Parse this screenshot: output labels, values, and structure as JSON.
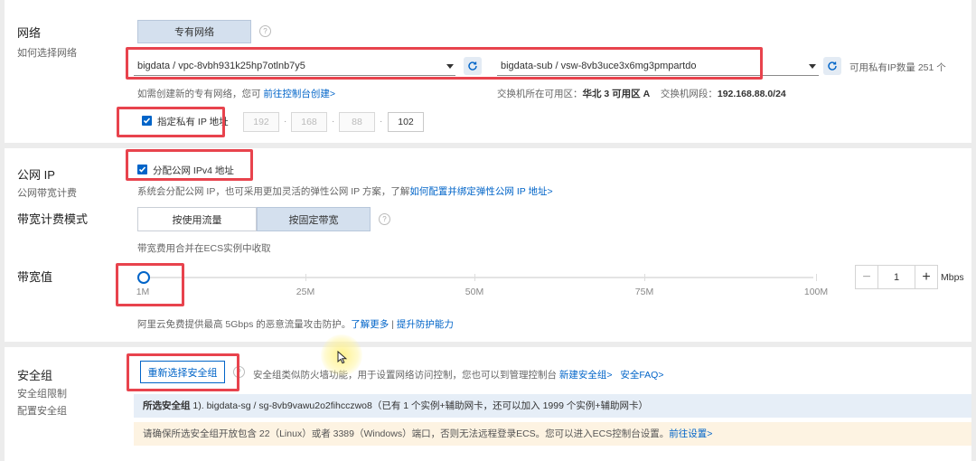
{
  "network": {
    "title": "网络",
    "subtitle": "如何选择网络",
    "vpc_button": "专有网络",
    "vpc_select": "bigdata / vpc-8vbh931k25hp7otlnb7y5",
    "vswitch_select": "bigdata-sub / vsw-8vb3uce3x6mg3pmpartdo",
    "available_ip": "可用私有IP数量 251 个",
    "create_hint": "如需创建新的专有网络，您可",
    "create_link": "前往控制台创建>",
    "zone_label": "交换机所在可用区：",
    "zone_value": "华北 3 可用区 A",
    "cidr_label": "交换机网段：",
    "cidr_value": "192.168.88.0/24",
    "private_ip_checkbox": "指定私有 IP 地址",
    "ip_octets": [
      "192",
      "168",
      "88",
      "102"
    ]
  },
  "public_ip": {
    "title": "公网 IP",
    "subtitle": "公网带宽计费",
    "checkbox": "分配公网 IPv4 地址",
    "hint": "系统会分配公网 IP，也可采用更加灵活的弹性公网 IP 方案，了解",
    "hint_link": "如何配置并绑定弹性公网 IP 地址>",
    "billing_title": "带宽计费模式",
    "billing_options": [
      "按使用流量",
      "按固定带宽"
    ],
    "billing_hint": "带宽费用合并在ECS实例中收取",
    "bandwidth_title": "带宽值",
    "slider_ticks": [
      "1M",
      "25M",
      "50M",
      "75M",
      "100M"
    ],
    "bandwidth_value": "1",
    "bandwidth_unit": "Mbps",
    "bandwidth_level": 1,
    "ddos_hint": "阿里云免费提供最高 5Gbps 的恶意流量攻击防护。",
    "ddos_link1": "了解更多",
    "ddos_sep": "|",
    "ddos_link2": "提升防护能力"
  },
  "security": {
    "title": "安全组",
    "subtitle1": "安全组限制",
    "subtitle2": "配置安全组",
    "reselect_button": "重新选择安全组",
    "desc": "安全组类似防火墙功能，用于设置网络访问控制，您也可以到管理控制台",
    "new_link": "新建安全组>",
    "faq_link": "安全FAQ>",
    "selected_label": "所选安全组",
    "selected_value": "1). bigdata-sg / sg-8vb9vawu2o2fihcczwo8（已有 1 个实例+辅助网卡，还可以加入 1999 个实例+辅助网卡）",
    "warning": "请确保所选安全组开放包含 22（Linux）或者 3389（Windows）端口，否则无法远程登录ECS。您可以进入ECS控制台设置。",
    "warning_link": "前往设置>"
  },
  "colors": {
    "accent": "#0064c8",
    "annotation": "#e8434d",
    "highlight": "#fff5a0"
  }
}
